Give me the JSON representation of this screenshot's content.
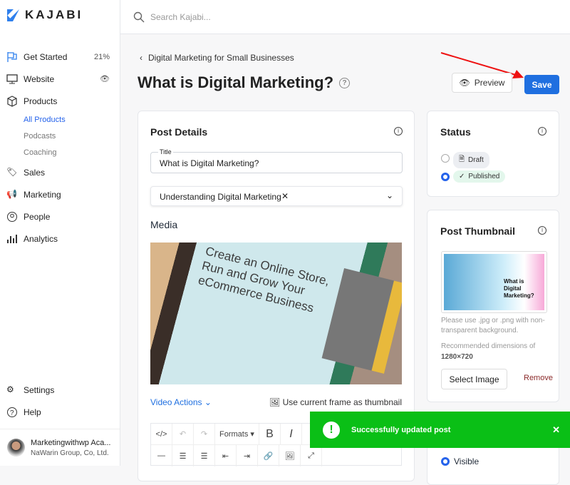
{
  "brand": {
    "name": "KAJABI",
    "color": "#2f80ed"
  },
  "search": {
    "placeholder": "Search Kajabi..."
  },
  "sidebar": {
    "items": [
      {
        "label": "Get Started",
        "icon": "flag-icon",
        "badge": "21%"
      },
      {
        "label": "Website",
        "icon": "monitor-icon"
      },
      {
        "label": "Products",
        "icon": "box-icon"
      }
    ],
    "subitems": [
      {
        "label": "All Products",
        "active": true
      },
      {
        "label": "Podcasts"
      },
      {
        "label": "Coaching"
      }
    ],
    "items2": [
      {
        "label": "Sales",
        "icon": "tag-icon"
      },
      {
        "label": "Marketing",
        "icon": "megaphone-icon"
      },
      {
        "label": "People",
        "icon": "user-circle-icon"
      },
      {
        "label": "Analytics",
        "icon": "bar-chart-icon"
      }
    ],
    "bottom": [
      {
        "label": "Settings",
        "icon": "gear-icon"
      },
      {
        "label": "Help",
        "icon": "help-icon"
      }
    ],
    "user": {
      "name": "Marketingwithwp Aca...",
      "company": "NaWarin Group, Co, Ltd."
    }
  },
  "breadcrumb": "Digital Marketing for Small Businesses",
  "page_title": "What is Digital Marketing?",
  "actions": {
    "preview": "Preview",
    "save": "Save",
    "accent": "#1f6fe0"
  },
  "post_details": {
    "heading": "Post Details",
    "title_label": "Title",
    "title_value": "What is Digital Marketing?",
    "category": "Understanding Digital Marketing",
    "media_heading": "Media",
    "video_actions": "Video Actions",
    "use_frame": "Use current frame as thumbnail",
    "media_text": [
      "Create an Online Store,",
      "Run and Grow Your",
      "eCommerce Business"
    ]
  },
  "editor": {
    "formats": "Formats"
  },
  "status": {
    "heading": "Status",
    "options": [
      {
        "label": "Draft",
        "selected": false
      },
      {
        "label": "Published",
        "selected": true
      }
    ]
  },
  "thumbnail": {
    "heading": "Post Thumbnail",
    "image_text": "What is Digital Marketing?",
    "hint": "Please use .jpg or .png with non-transparent background.",
    "rec": "Recommended dimensions of",
    "dims": "1280×720",
    "select": "Select Image",
    "remove": "Remove"
  },
  "visibility": {
    "option": "Visible"
  },
  "toast": {
    "message": "Successfully updated post",
    "color": "#0abf16"
  }
}
